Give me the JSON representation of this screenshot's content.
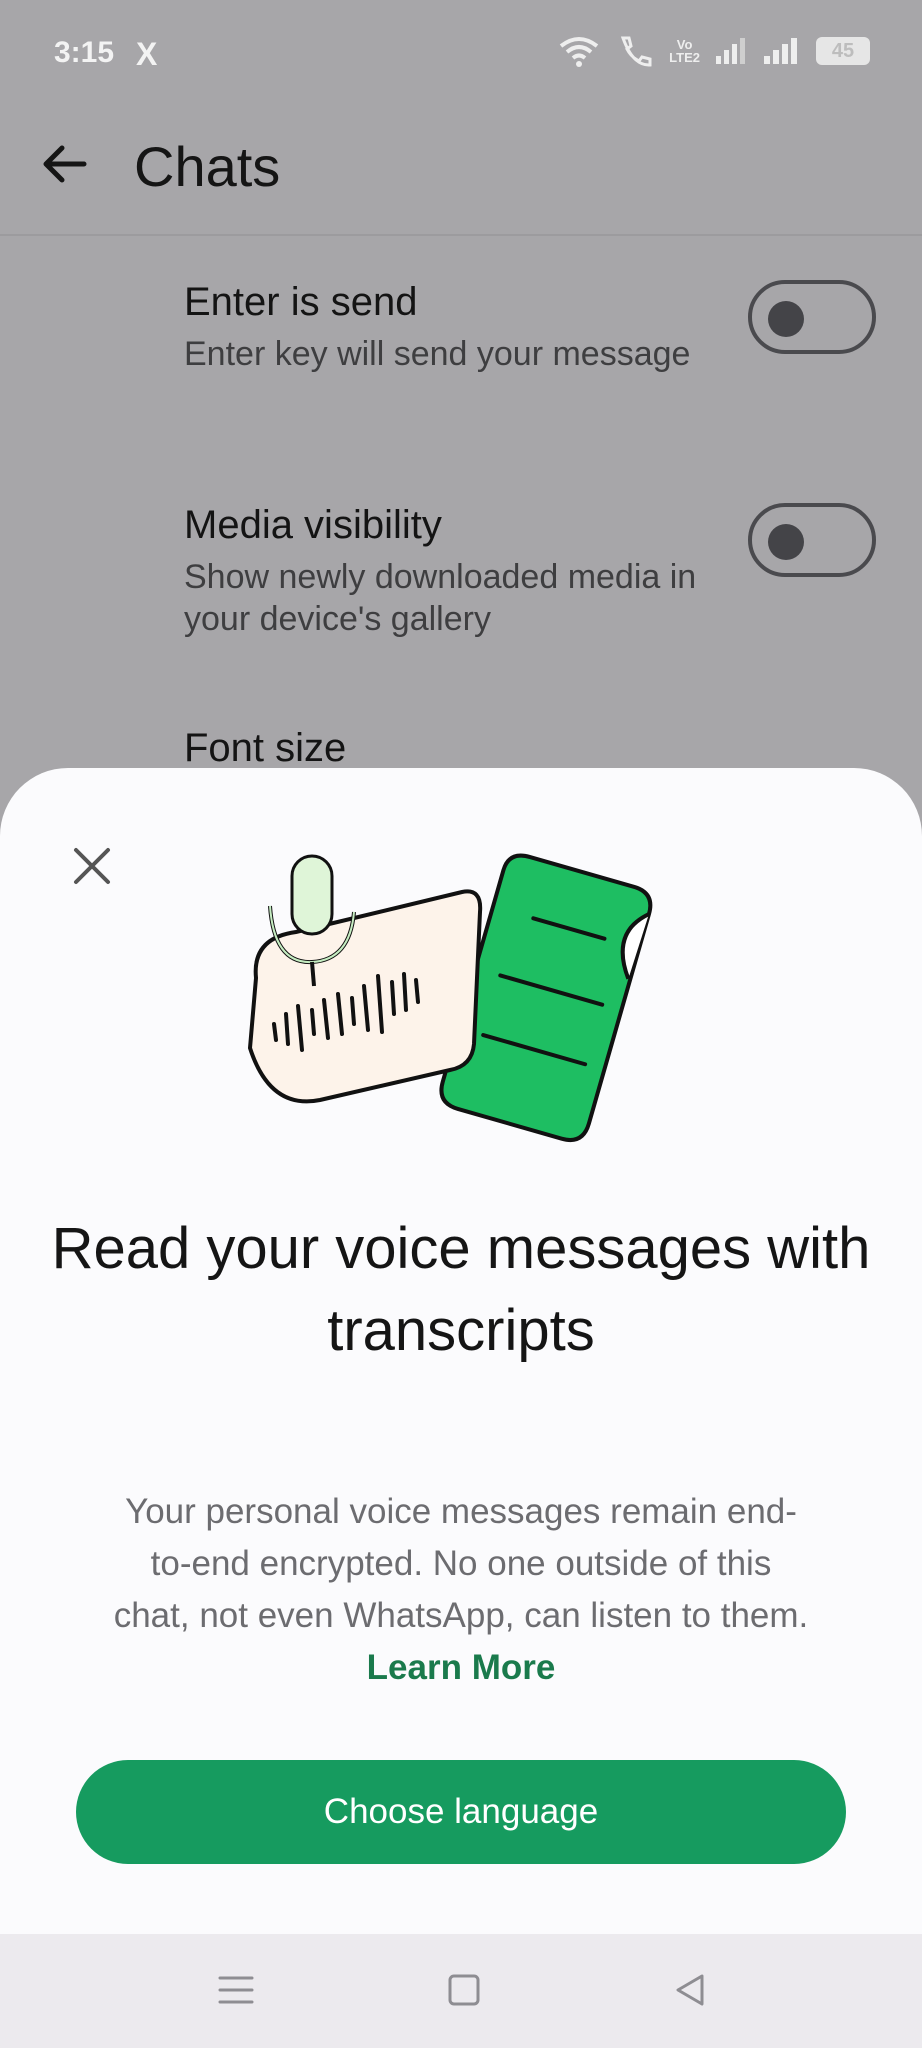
{
  "status_bar": {
    "time": "3:15",
    "app_icon": "X",
    "volte": [
      "Vo",
      "LTE2"
    ],
    "battery": "45"
  },
  "app_bar": {
    "title": "Chats"
  },
  "settings": [
    {
      "title": "Enter is send",
      "subtitle": "Enter key will send your message",
      "toggle_on": false
    },
    {
      "title": "Media visibility",
      "subtitle": "Show newly downloaded media in your device's gallery",
      "toggle_on": false
    },
    {
      "title": "Font size"
    }
  ],
  "sheet": {
    "title": "Read your voice messages with transcripts",
    "body": "Your personal voice messages remain end-to-end encrypted. No one outside of this chat, not even WhatsApp, can listen to them.",
    "link": "Learn More",
    "button": "Choose language"
  },
  "colors": {
    "accent": "#169b5f",
    "link": "#1a7a4c",
    "scrim": "#a7a6a9",
    "doc_green": "#1ebe62"
  }
}
